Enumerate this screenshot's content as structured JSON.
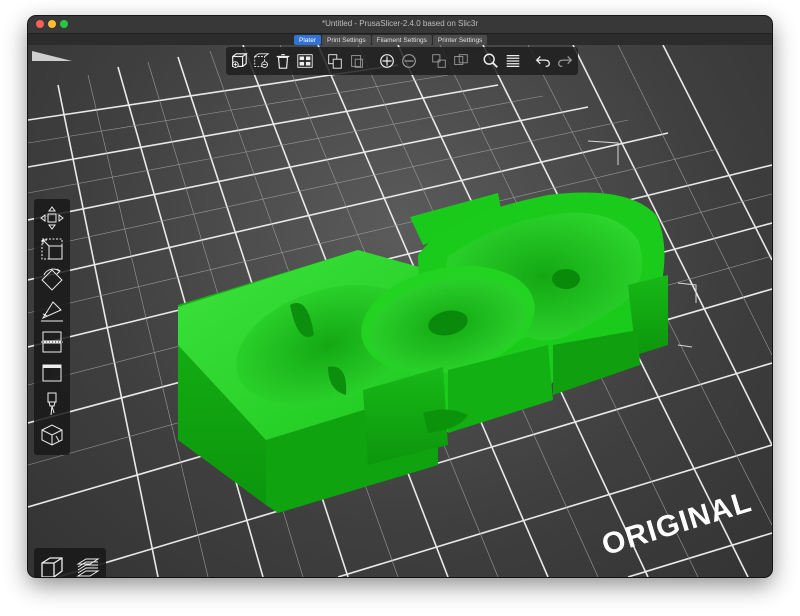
{
  "window": {
    "title": "*Untitled - PrusaSlicer-2.4.0 based on Slic3r"
  },
  "tabs": [
    {
      "label": "Plater",
      "active": true
    },
    {
      "label": "Print Settings",
      "active": false
    },
    {
      "label": "Filament Settings",
      "active": false
    },
    {
      "label": "Printer Settings",
      "active": false
    }
  ],
  "toolbar": {
    "buttons": [
      "add-icon",
      "delete-icon",
      "delete-all-icon",
      "arrange-icon",
      "copy-icon",
      "paste-icon",
      "add-instance-icon",
      "remove-instance-icon",
      "split-objects-icon",
      "split-parts-icon",
      "search-icon",
      "layers-editing-icon",
      "undo-icon",
      "redo-icon"
    ]
  },
  "sidebar_tools": [
    "move-icon",
    "scale-icon",
    "rotate-icon",
    "place-on-face-icon",
    "cut-icon",
    "hollow-icon",
    "paint-support-icon",
    "measure-icon"
  ],
  "bed": {
    "label": "ORIGINAL"
  },
  "view_buttons": [
    "3d-view-icon",
    "preview-icon"
  ],
  "colors": {
    "model": "#1fd41f",
    "model_dark": "#0a9e0a",
    "accent_tab": "#2f73d7",
    "bed_grid": "#e9e9e9"
  }
}
